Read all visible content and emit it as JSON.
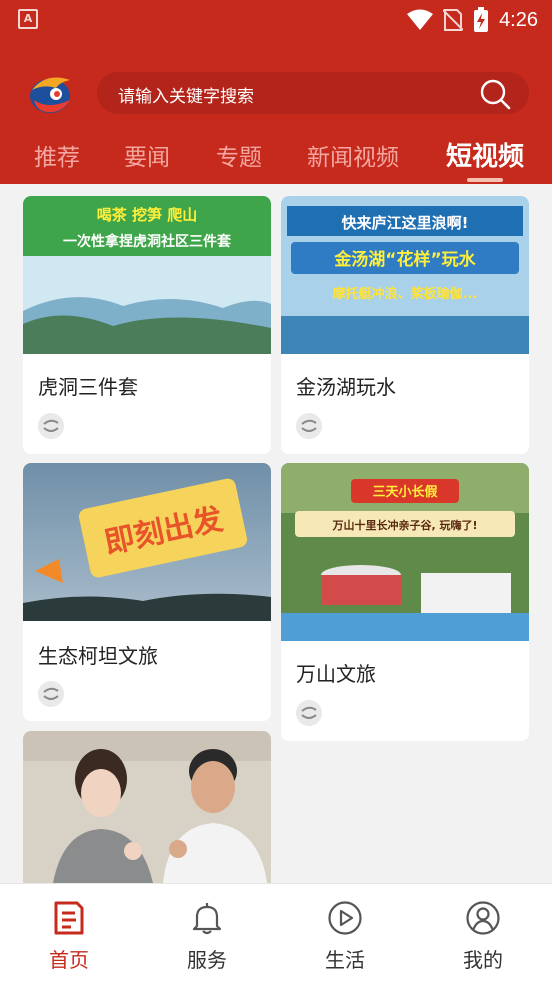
{
  "status_bar": {
    "app_icon_letter": "A",
    "time": "4:26",
    "icons": [
      "wifi-icon",
      "sim-off-icon",
      "battery-charging-icon"
    ]
  },
  "header": {
    "logo": "app-logo",
    "search_placeholder": "请输入关键字搜索",
    "search_icon": "search-icon",
    "tabs": [
      {
        "label": "推荐",
        "active": false
      },
      {
        "label": "要闻",
        "active": false
      },
      {
        "label": "专题",
        "active": false
      },
      {
        "label": "新闻视频",
        "active": false
      },
      {
        "label": "短视频",
        "active": true
      }
    ]
  },
  "feed": {
    "cards": [
      {
        "title": "虎洞三件套",
        "thumb_banner_top": "喝茶 挖笋 爬山",
        "thumb_banner_bottom": "一次性拿捏虎洞社区三件套",
        "badge_icon": "source-logo-icon"
      },
      {
        "title": "金汤湖玩水",
        "thumb_banner_top": "快来庐江这里浪啊!",
        "thumb_banner_middle": "金汤湖“花样”玩水",
        "thumb_banner_bottom": "摩托艇冲浪、桨板瑜伽...",
        "badge_icon": "source-logo-icon"
      },
      {
        "title": "生态柯坦文旅",
        "thumb_banner": "即刻出发",
        "badge_icon": "source-logo-icon"
      },
      {
        "title": "万山文旅",
        "thumb_banner_top": "三天小长假",
        "thumb_banner_bottom": "万山十里长冲亲子谷, 玩嗨了!",
        "badge_icon": "source-logo-icon"
      },
      {
        "title": "",
        "thumb_description_icon": "video-thumbnail"
      }
    ]
  },
  "bottom_nav": {
    "items": [
      {
        "label": "首页",
        "icon": "home-news-icon",
        "active": true
      },
      {
        "label": "服务",
        "icon": "bell-icon",
        "active": false
      },
      {
        "label": "生活",
        "icon": "play-circle-icon",
        "active": false
      },
      {
        "label": "我的",
        "icon": "user-profile-icon",
        "active": false
      }
    ]
  },
  "colors": {
    "brand_red": "#c62a1c",
    "search_bg": "#b3251a",
    "tab_inactive": "#f3a7a0",
    "page_bg": "#f2f2f2"
  }
}
